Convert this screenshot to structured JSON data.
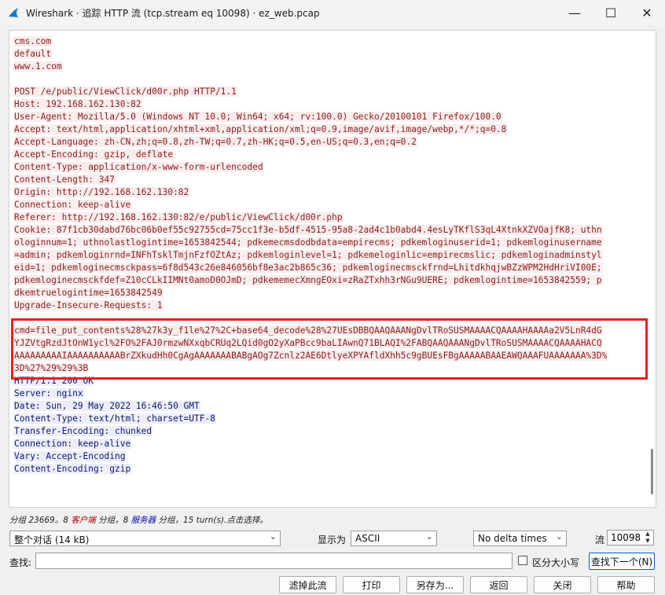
{
  "window": {
    "title": "Wireshark · 追踪 HTTP 流 (tcp.stream eq 10098) · ez_web.pcap",
    "controls": [
      "—",
      "☐",
      "✕"
    ]
  },
  "stream_lines": [
    {
      "side": "client",
      "text": "cms.com"
    },
    {
      "side": "client",
      "text": "default"
    },
    {
      "side": "client",
      "text": "www.1.com"
    },
    {
      "side": "blank",
      "text": ""
    },
    {
      "side": "client",
      "text": "POST /e/public/ViewClick/d00r.php HTTP/1.1"
    },
    {
      "side": "client",
      "text": "Host: 192.168.162.130:82"
    },
    {
      "side": "client",
      "text": "User-Agent: Mozilla/5.0 (Windows NT 10.0; Win64; x64; rv:100.0) Gecko/20100101 Firefox/100.0"
    },
    {
      "side": "client",
      "text": "Accept: text/html,application/xhtml+xml,application/xml;q=0.9,image/avif,image/webp,*/*;q=0.8"
    },
    {
      "side": "client",
      "text": "Accept-Language: zh-CN,zh;q=0.8,zh-TW;q=0.7,zh-HK;q=0.5,en-US;q=0.3,en;q=0.2"
    },
    {
      "side": "client",
      "text": "Accept-Encoding: gzip, deflate"
    },
    {
      "side": "client",
      "text": "Content-Type: application/x-www-form-urlencoded"
    },
    {
      "side": "client",
      "text": "Content-Length: 347"
    },
    {
      "side": "client",
      "text": "Origin: http://192.168.162.130:82"
    },
    {
      "side": "client",
      "text": "Connection: keep-alive"
    },
    {
      "side": "client",
      "text": "Referer: http://192.168.162.130:82/e/public/ViewClick/d00r.php"
    },
    {
      "side": "client",
      "text": "Cookie: 87f1cb30dabd76bc06b0ef55c92755cd=75cc1f3e-b5df-4515-95a8-2ad4c1b0abd4.4esLyTKflS3qL4XtnkXZVOajfK8; uthn"
    },
    {
      "side": "client",
      "text": "ologinnum=1; uthnolastlogintime=1653842544; pdkemecmsdodbdata=empirecms; pdkemloginuserid=1; pdkemloginusername"
    },
    {
      "side": "client",
      "text": "=admin; pdkemloginrnd=INFhTsklTmjnFzfOZtAz; pdkemloginlevel=1; pdkemeloginlic=empirecmslic; pdkemloginadminstyl"
    },
    {
      "side": "client",
      "text": "eid=1; pdkemloginecmsckpass=6f8d543c26e846056bf8e3ac2b865c36; pdkemloginecmsckfrnd=LhitdkhqjwBZzWPM2HdHriVI00E;"
    },
    {
      "side": "client",
      "text": "pdkemloginecmsckfdef=Z10cCLkIIMNt0amoD0OJmD; pdkememecXmngEOxi=zRaZTxhh3rNGu9UERE; pdkemlogintime=1653842559; p"
    },
    {
      "side": "client",
      "text": "dkemtruelogintime=1653842549"
    },
    {
      "side": "client",
      "text": "Upgrade-Insecure-Requests: 1"
    },
    {
      "side": "blank",
      "text": ""
    },
    {
      "side": "client",
      "text": "cmd=file_put_contents%28%27k3y_f1le%27%2C+base64_decode%28%27UEsDBBQAAQAAANgDvlTRoSUSMAAAACQAAAAHAAAAa2V5LnR4dG"
    },
    {
      "side": "client",
      "text": "YJZVtgRzdJtOnW1ycl%2FO%2FAJ0rmzwNXxqbCRUq2LQid0gO2yXaPBcc9baLIAwnQ71BLAQI%2FABQAAQAAANgDvlTRoSUSMAAAACQAAAAHACQ"
    },
    {
      "side": "client",
      "text": "AAAAAAAAAIAAAAAAAAAABrZXkudHh0CgAgAAAAAAABABgAOg7Zcnlz2AE6DtlyeXPYAfldXhh5c9gBUEsFBgAAAAABAAEAWQAAAFUAAAAAAA%3D%"
    },
    {
      "side": "client",
      "text": "3D%27%29%29%3B"
    },
    {
      "side": "server",
      "text": "HTTP/1.1 200 OK"
    },
    {
      "side": "server",
      "text": "Server: nginx"
    },
    {
      "side": "server",
      "text": "Date: Sun, 29 May 2022 16:46:50 GMT"
    },
    {
      "side": "server",
      "text": "Content-Type: text/html; charset=UTF-8"
    },
    {
      "side": "server",
      "text": "Transfer-Encoding: chunked"
    },
    {
      "side": "server",
      "text": "Connection: keep-alive"
    },
    {
      "side": "server",
      "text": "Vary: Accept-Encoding"
    },
    {
      "side": "server",
      "text": "Content-Encoding: gzip"
    }
  ],
  "status": {
    "prefix": "分组 23669。8 ",
    "client_label": "客户端",
    "mid": " 分组，8 ",
    "server_label": "服务器",
    "suffix": " 分组，15 turn(s).点击选择。"
  },
  "controls": {
    "conversation_select": "整个对话 (14 kB)",
    "show_as_label": "显示为",
    "show_as_value": "ASCII",
    "delta_value": "No delta times",
    "stream_label": "流",
    "stream_number": "10098",
    "find_label": "查找:",
    "find_value": "",
    "case_label": "区分大小写",
    "find_next": "查找下一个(N)"
  },
  "buttons": {
    "filter_out": "滤掉此流",
    "print": "打印",
    "save_as": "另存为...",
    "back": "返回",
    "close": "关闭",
    "help": "帮助"
  },
  "colors": {
    "client_text": "#8b1c1c",
    "client_bg": "#fbeded",
    "server_text": "#0d1570",
    "server_bg": "#eceffb",
    "highlight_box": "#e6211f"
  },
  "icons": {
    "app": "wireshark-fin-icon",
    "minimize": "minimize-icon",
    "maximize": "maximize-icon",
    "close": "close-icon"
  }
}
